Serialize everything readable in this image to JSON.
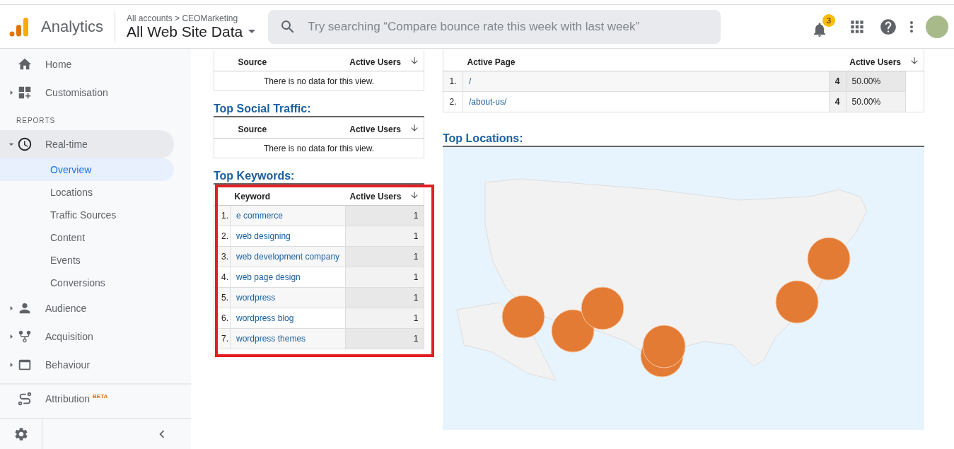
{
  "header": {
    "product": "Analytics",
    "account_path": "All accounts > CEOMarketing",
    "property": "All Web Site Data",
    "search": {
      "placeholder": "Try searching “Compare bounce rate this week with last week”"
    },
    "notifications": "3"
  },
  "sidebar": {
    "items": [
      {
        "kind": "item",
        "label": "Home",
        "expandable": false,
        "expanded": false
      },
      {
        "kind": "item",
        "label": "Customisation",
        "expandable": true,
        "expanded": false
      },
      {
        "kind": "section",
        "label": "REPORTS"
      },
      {
        "kind": "item",
        "label": "Real-time",
        "expandable": true,
        "expanded": true,
        "children": [
          {
            "label": "Overview",
            "selected": true
          },
          {
            "label": "Locations",
            "selected": false
          },
          {
            "label": "Traffic Sources",
            "selected": false
          },
          {
            "label": "Content",
            "selected": false
          },
          {
            "label": "Events",
            "selected": false
          },
          {
            "label": "Conversions",
            "selected": false
          }
        ]
      },
      {
        "kind": "item",
        "label": "Audience",
        "expandable": true,
        "expanded": false
      },
      {
        "kind": "item",
        "label": "Acquisition",
        "expandable": true,
        "expanded": false
      },
      {
        "kind": "item",
        "label": "Behaviour",
        "expandable": true,
        "expanded": false
      },
      {
        "kind": "divider"
      },
      {
        "kind": "item",
        "label": "Attribution",
        "badge": "BETA",
        "expandable": false,
        "expanded": false
      }
    ]
  },
  "left_panels": [
    {
      "columns": [
        "Source",
        "Active Users"
      ],
      "empty_text": "There is no data for this view."
    },
    {
      "title": "Top Social Traffic:",
      "columns": [
        "Source",
        "Active Users"
      ],
      "empty_text": "There is no data for this view."
    },
    {
      "title": "Top Keywords:",
      "highlighted": true,
      "columns": [
        "Keyword",
        "Active Users"
      ],
      "rows": [
        {
          "rank": "1.",
          "keyword": "e commerce",
          "users": "1"
        },
        {
          "rank": "2.",
          "keyword": "web designing",
          "users": "1"
        },
        {
          "rank": "3.",
          "keyword": "web development company",
          "users": "1"
        },
        {
          "rank": "4.",
          "keyword": "web page design",
          "users": "1"
        },
        {
          "rank": "5.",
          "keyword": "wordpress",
          "users": "1"
        },
        {
          "rank": "6.",
          "keyword": "wordpress blog",
          "users": "1"
        },
        {
          "rank": "7.",
          "keyword": "wordpress themes",
          "users": "1"
        }
      ]
    }
  ],
  "active_pages": {
    "columns": [
      "Active Page",
      "Active Users"
    ],
    "rows": [
      {
        "rank": "1.",
        "page": "/",
        "users": "4",
        "share": "50.00%"
      },
      {
        "rank": "2.",
        "page": "/about-us/",
        "users": "4",
        "share": "50.00%"
      }
    ]
  },
  "top_locations": {
    "title": "Top Locations:"
  }
}
